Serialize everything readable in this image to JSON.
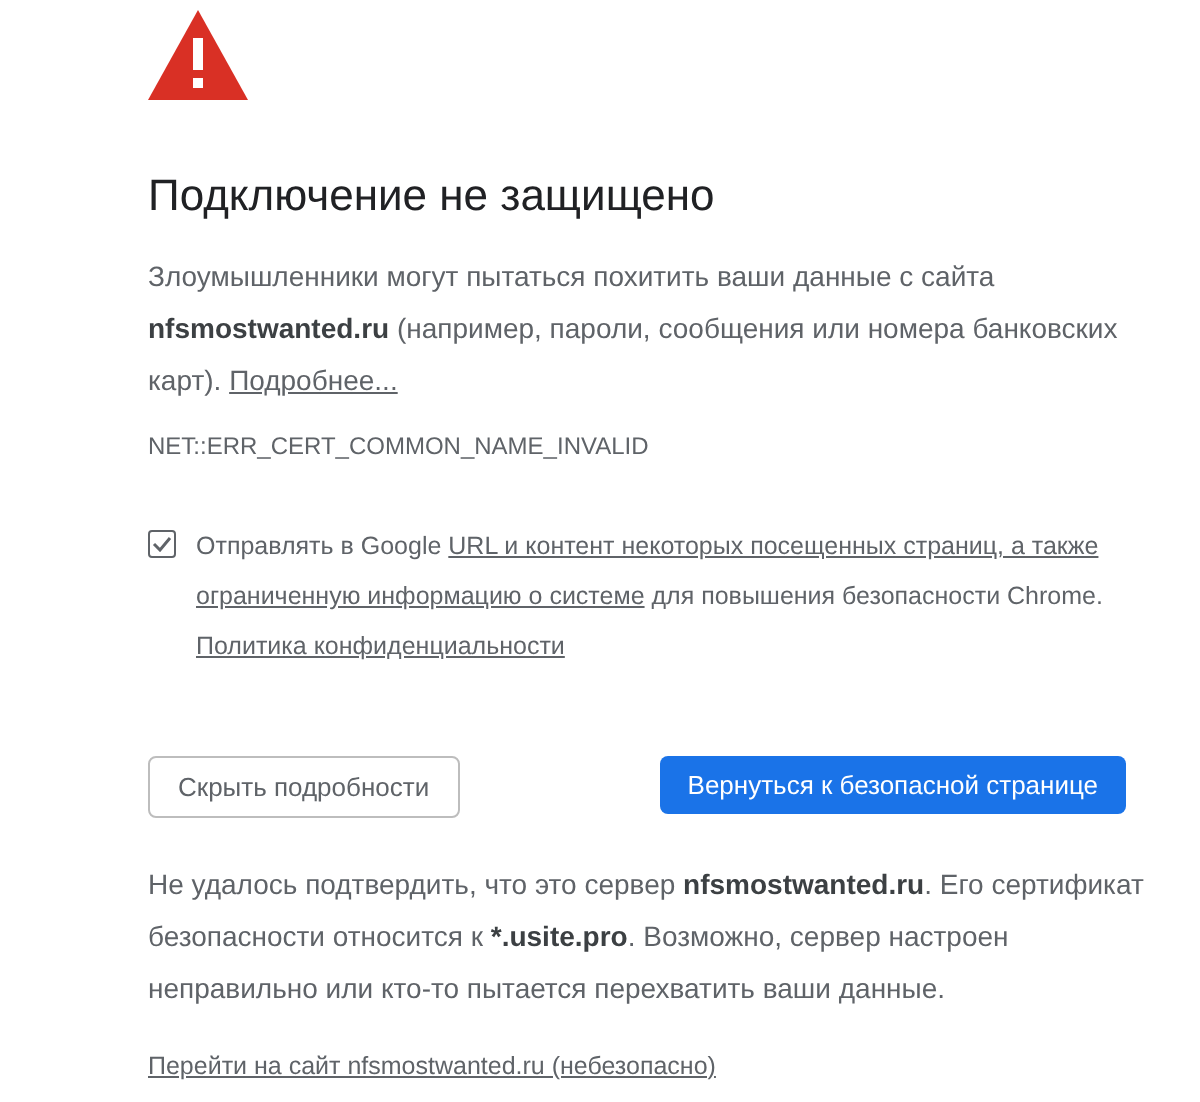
{
  "title": "Подключение не защищено",
  "intro": [
    {
      "kind": "text",
      "text": "Злоумышленники могут пытаться похитить ваши данные с сайта **nfsmostwanted.ru** (например, пароли, сообщения или номера банковских карт). "
    },
    {
      "kind": "link",
      "text": "Подробнее..."
    }
  ],
  "error_code": "NET::ERR_CERT_COMMON_NAME_INVALID",
  "opt_in": {
    "checked": true,
    "segments": [
      {
        "kind": "text",
        "text": "Отправлять в Google "
      },
      {
        "kind": "link",
        "text": "URL и контент некоторых посещенных страниц, а также"
      },
      {
        "kind": "link",
        "text": "ограниченную информацию о системе"
      },
      {
        "kind": "text",
        "text": " для повышения безопасности Chrome. "
      },
      {
        "kind": "link",
        "text": "Политика конфиденциальности"
      }
    ]
  },
  "buttons": [
    {
      "kind": "secondary",
      "label": "Скрыть подробности"
    },
    {
      "kind": "primary",
      "label": "Вернуться к безопасной странице"
    }
  ],
  "details": "Не удалось подтвердить, что это сервер **nfsmostwanted.ru**. Его сертификат безопасности относится к ***.usite.pro**. Возможно, сервер настроен неправильно или кто-то пытается перехватить ваши данные.",
  "proceed_link": "Перейти на сайт nfsmostwanted.ru (небезопасно)"
}
